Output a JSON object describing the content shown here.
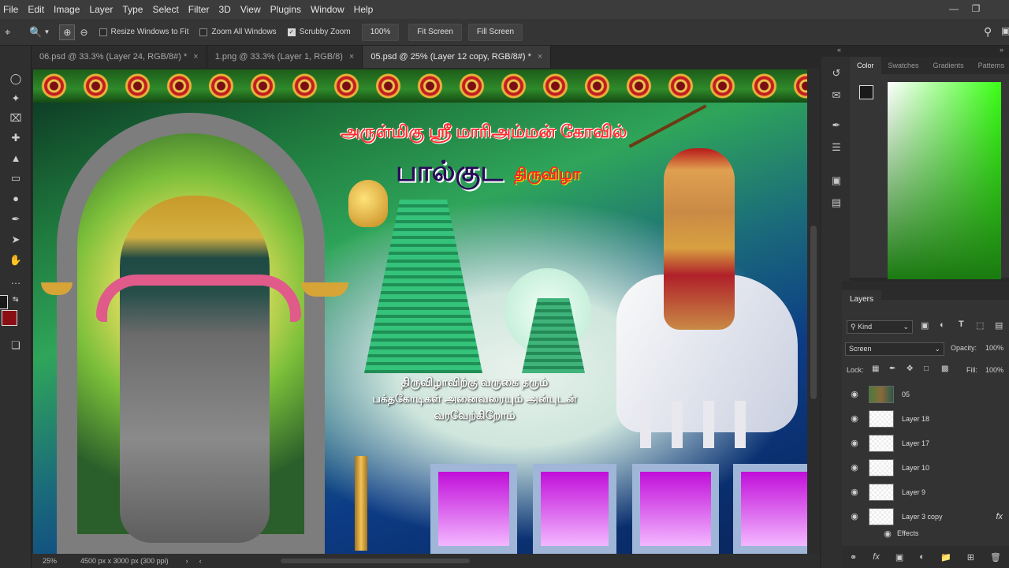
{
  "menu": [
    "File",
    "Edit",
    "Image",
    "Layer",
    "Type",
    "Select",
    "Filter",
    "3D",
    "View",
    "Plugins",
    "Window",
    "Help"
  ],
  "options": {
    "resize": "Resize Windows to Fit",
    "zoom_all": "Zoom All Windows",
    "scrubby": "Scrubby Zoom",
    "zoom_value": "100%",
    "fit": "Fit Screen",
    "fill": "Fill Screen"
  },
  "tabs": [
    {
      "label": "06.psd @ 33.3% (Layer 24, RGB/8#) *"
    },
    {
      "label": "1.png @ 33.3% (Layer 1, RGB/8)"
    },
    {
      "label": "05.psd @ 25% (Layer 12 copy, RGB/8#) *"
    }
  ],
  "art": {
    "title_line1": "அருள்மிகு ஸ்ரீ மாரிஅம்மன் கோவில்",
    "title_main": "பால்குட",
    "title_sub": "திருவிழா",
    "welcome1": "திருவிழாவிற்கு வருகை தரும்",
    "welcome2": "பக்தகோடிகள் அனைவரையும் அன்புடன்",
    "welcome3": "வரவேற்கிறோம்"
  },
  "status": {
    "zoom": "25%",
    "dims": "4500 px x 3000 px (300 ppi)"
  },
  "color_panel": {
    "tabs": [
      "Color",
      "Swatches",
      "Gradients",
      "Patterns"
    ],
    "fg": "#1a1a1a",
    "bg": "#8a0f14"
  },
  "layers": {
    "title": "Layers",
    "kind": "Kind",
    "blend": "Screen",
    "opacity_label": "Opacity:",
    "opacity": "100%",
    "lock_label": "Lock:",
    "fill_label": "Fill:",
    "fill": "100%",
    "items": [
      {
        "name": "05"
      },
      {
        "name": "Layer 18"
      },
      {
        "name": "Layer 17"
      },
      {
        "name": "Layer 10"
      },
      {
        "name": "Layer 9"
      },
      {
        "name": "Layer 3 copy"
      }
    ],
    "effects": "Effects",
    "fx": "fx"
  }
}
